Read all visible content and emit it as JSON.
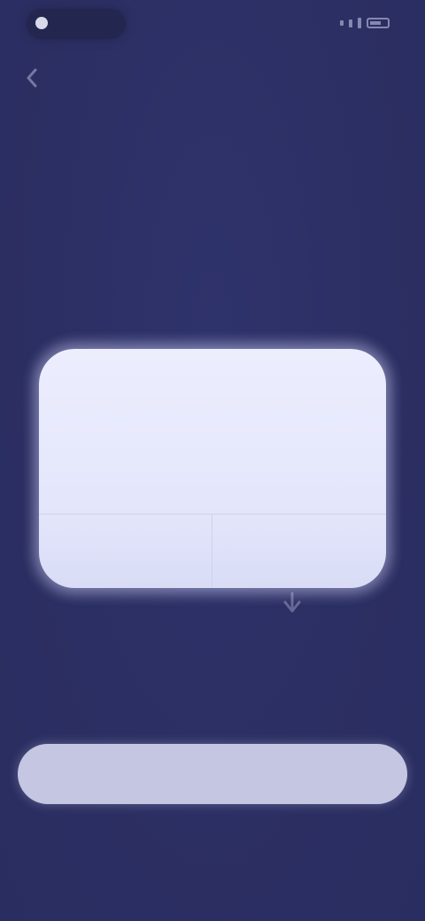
{
  "status_bar": {
    "time": "",
    "icons": [
      "signal-icon",
      "battery-icon"
    ]
  },
  "nav": {
    "back_icon": "chevron-left-icon"
  },
  "title": "",
  "permission_card": {
    "heading": "",
    "body": "",
    "deny_label": "",
    "allow_label": ""
  },
  "footer": {
    "note": "",
    "primary_label": ""
  },
  "colors": {
    "background": "#2c2f63",
    "card": "#e6e8fc",
    "primary_button": "#c4c6e2",
    "text_light": "#f2f3fb"
  }
}
